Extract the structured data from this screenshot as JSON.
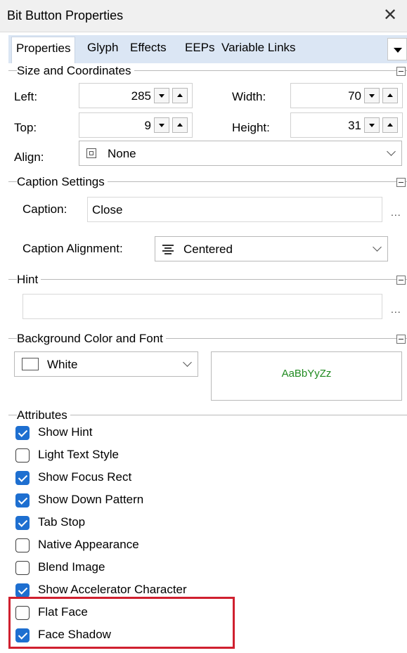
{
  "window": {
    "title": "Bit Button Properties"
  },
  "tabs": [
    "Properties",
    "Glyph",
    "Effects",
    "EEPs",
    "Variable Links"
  ],
  "size_coordinates": {
    "title": "Size and Coordinates",
    "left_label": "Left:",
    "left_value": "285",
    "width_label": "Width:",
    "width_value": "70",
    "top_label": "Top:",
    "top_value": "9",
    "height_label": "Height:",
    "height_value": "31",
    "align_label": "Align:",
    "align_value": "None"
  },
  "caption_settings": {
    "title": "Caption Settings",
    "caption_label": "Caption:",
    "caption_value": "Close",
    "alignment_label": "Caption Alignment:",
    "alignment_value": "Centered",
    "ellipsis": "..."
  },
  "hint": {
    "title": "Hint",
    "value": "",
    "ellipsis": "..."
  },
  "background_font": {
    "title": "Background Color and Font",
    "color_value": "White",
    "font_preview": "AaBbYyZz"
  },
  "attributes": {
    "title": "Attributes",
    "items": [
      {
        "label": "Show Hint",
        "checked": true
      },
      {
        "label": "Light Text Style",
        "checked": false
      },
      {
        "label": "Show Focus Rect",
        "checked": true
      },
      {
        "label": "Show Down Pattern",
        "checked": true
      },
      {
        "label": "Tab Stop",
        "checked": true
      },
      {
        "label": "Native Appearance",
        "checked": false
      },
      {
        "label": "Blend Image",
        "checked": false
      },
      {
        "label": "Show Accelerator Character",
        "checked": true
      },
      {
        "label": "Flat Face",
        "checked": false
      },
      {
        "label": "Face Shadow",
        "checked": true
      }
    ]
  },
  "colors": {
    "accent": "#1e6fd0",
    "highlight": "#d0202f",
    "preview_text": "#1f8a1f"
  }
}
